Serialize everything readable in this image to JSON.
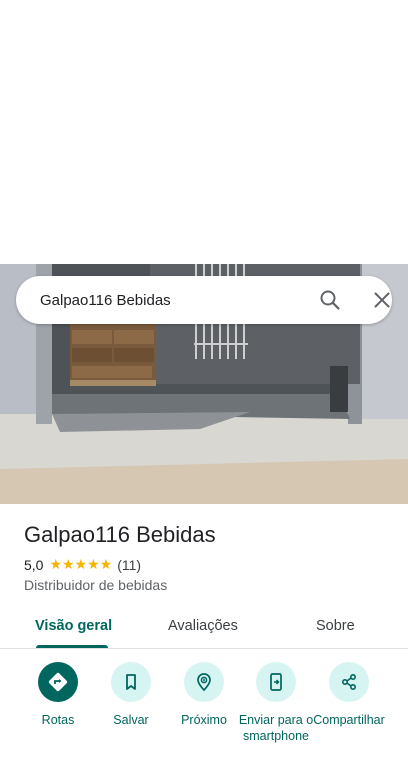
{
  "search": {
    "query": "Galpao116 Bebidas"
  },
  "place": {
    "name": "Galpao116 Bebidas",
    "rating": "5,0",
    "stars": "★★★★★",
    "review_count": "(11)",
    "category": "Distribuidor de bebidas"
  },
  "tabs": [
    {
      "label": "Visão geral",
      "active": true
    },
    {
      "label": "Avaliações",
      "active": false
    },
    {
      "label": "Sobre",
      "active": false
    }
  ],
  "actions": [
    {
      "label": "Rotas",
      "icon": "directions-icon"
    },
    {
      "label": "Salvar",
      "icon": "bookmark-icon"
    },
    {
      "label": "Próximo",
      "icon": "nearby-icon"
    },
    {
      "label": "Enviar para o smartphone",
      "icon": "send-to-phone-icon"
    },
    {
      "label": "Compartilhar",
      "icon": "share-icon"
    }
  ],
  "colors": {
    "accent": "#00665e",
    "action_bg": "#d5f4f2",
    "star": "#f4b400"
  }
}
